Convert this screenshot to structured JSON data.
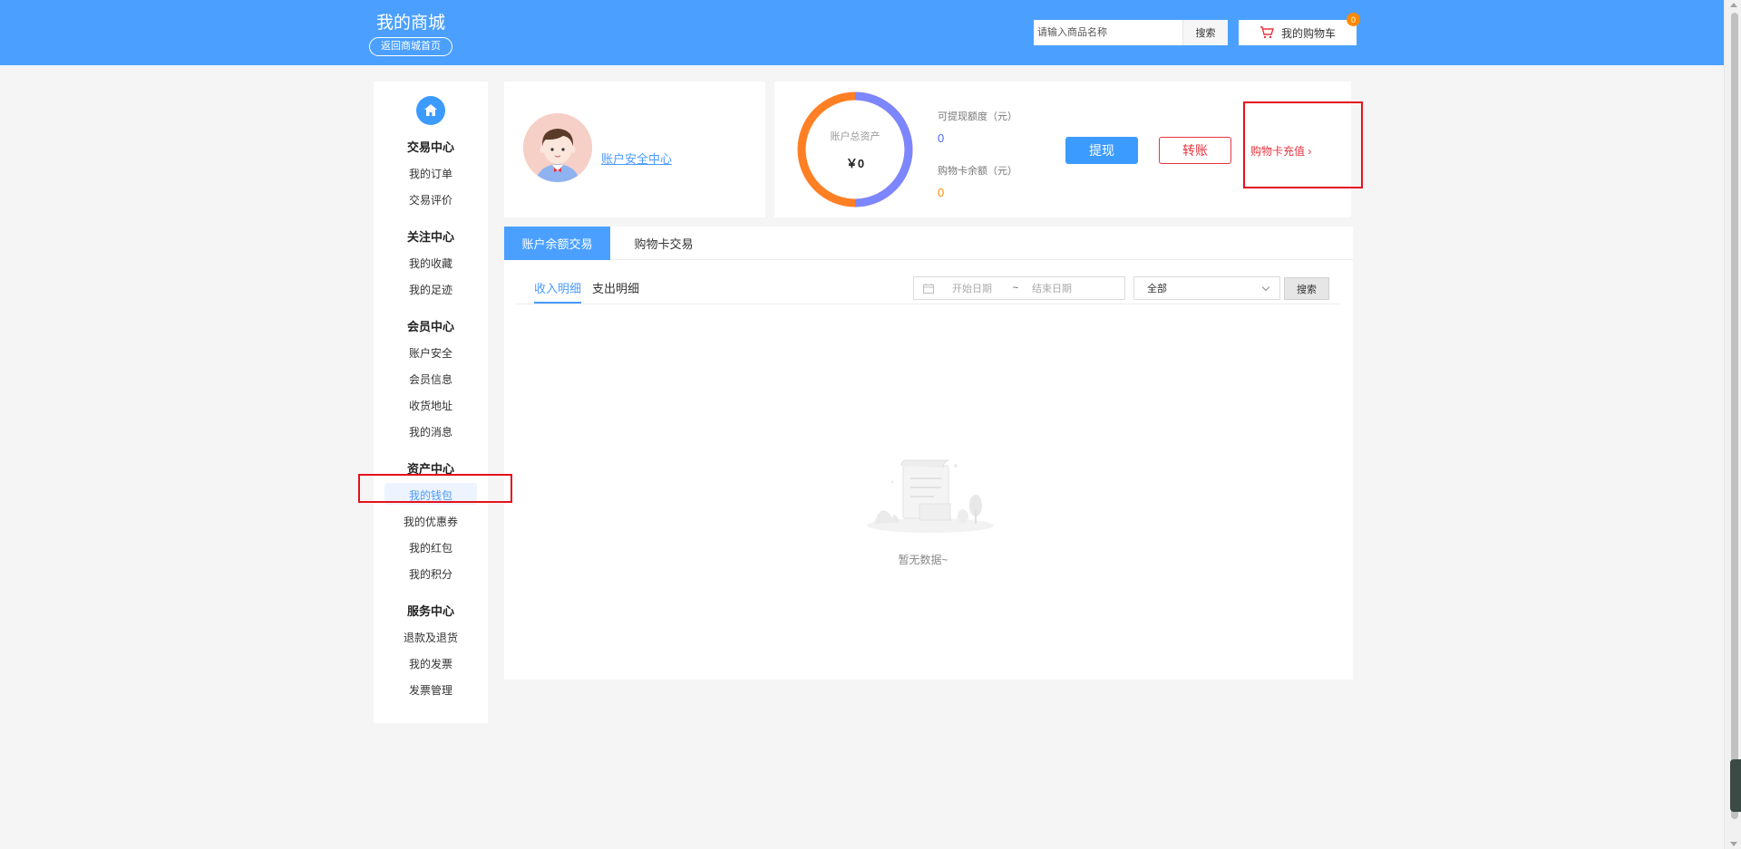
{
  "header": {
    "brand_title": "我的商城",
    "home_button": "返回商城首页",
    "search_placeholder": "请输入商品名称",
    "search_button": "搜索",
    "cart_label": "我的购物车",
    "cart_count": "0"
  },
  "sidebar": {
    "groups": [
      {
        "title": "交易中心",
        "items": [
          "我的订单",
          "交易评价"
        ]
      },
      {
        "title": "关注中心",
        "items": [
          "我的收藏",
          "我的足迹"
        ]
      },
      {
        "title": "会员中心",
        "items": [
          "账户安全",
          "会员信息",
          "收货地址",
          "我的消息"
        ]
      },
      {
        "title": "资产中心",
        "items": [
          "我的钱包",
          "我的优惠券",
          "我的红包",
          "我的积分"
        ]
      },
      {
        "title": "服务中心",
        "items": [
          "退款及退货",
          "我的发票",
          "发票管理"
        ]
      }
    ],
    "active_item": "我的钱包"
  },
  "profile": {
    "security_link": "账户安全中心"
  },
  "assets": {
    "total_label": "账户总资产",
    "total_value": "￥0",
    "withdrawable_label": "可提现额度（元）",
    "withdrawable_value": "0",
    "card_balance_label": "购物卡余额（元）",
    "card_balance_value": "0",
    "withdraw_button": "提现",
    "transfer_button": "转账",
    "recharge_link": "购物卡充值 ›"
  },
  "tabs": [
    "账户余额交易",
    "购物卡交易"
  ],
  "subtabs": [
    "收入明细",
    "支出明细"
  ],
  "filter": {
    "start_placeholder": "开始日期",
    "separator": "~",
    "end_placeholder": "结束日期",
    "type_value": "全部",
    "search_button": "搜索"
  },
  "empty_text": "暂无数据~",
  "colors": {
    "header_bg": "#4ba0ff",
    "primary": "#3c9bff",
    "danger": "#e8343f",
    "withdrawable_value": "#4a6cff",
    "card_value": "#ff8a00"
  }
}
